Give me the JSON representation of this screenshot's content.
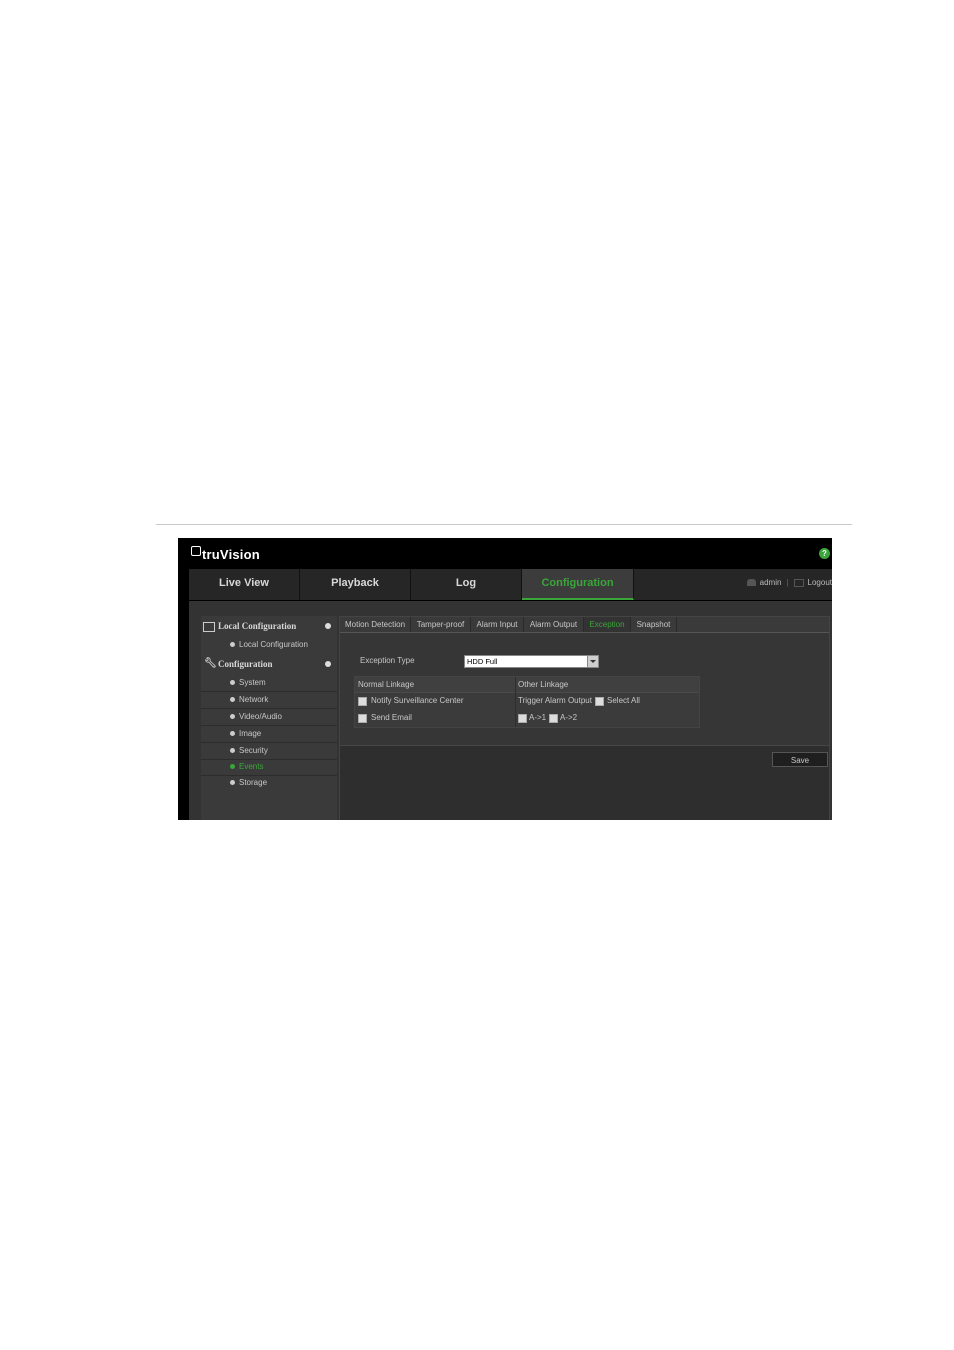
{
  "brand": {
    "logo_text": "truVision",
    "help_icon": "help-icon"
  },
  "nav": {
    "tabs": [
      {
        "label": "Live View"
      },
      {
        "label": "Playback"
      },
      {
        "label": "Log"
      },
      {
        "label": "Configuration",
        "active": true
      }
    ],
    "user": "admin",
    "logout": "Logout"
  },
  "sidebar": {
    "local_configuration": {
      "title": "Local Configuration",
      "items": [
        {
          "label": "Local Configuration"
        }
      ]
    },
    "configuration": {
      "title": "Configuration",
      "items": [
        {
          "label": "System"
        },
        {
          "label": "Network"
        },
        {
          "label": "Video/Audio"
        },
        {
          "label": "Image"
        },
        {
          "label": "Security"
        },
        {
          "label": "Events",
          "active": true
        },
        {
          "label": "Storage"
        }
      ]
    }
  },
  "subtabs": [
    {
      "label": "Motion Detection"
    },
    {
      "label": "Tamper-proof"
    },
    {
      "label": "Alarm Input"
    },
    {
      "label": "Alarm Output"
    },
    {
      "label": "Exception",
      "active": true
    },
    {
      "label": "Snapshot"
    }
  ],
  "exception": {
    "type_label": "Exception Type",
    "type_value": "HDD Full",
    "normal_linkage_header": "Normal Linkage",
    "other_linkage_header": "Other Linkage",
    "notify_surveillance_center": "Notify Surveillance Center",
    "send_email": "Send Email",
    "trigger_alarm_output": "Trigger Alarm Output",
    "select_all": "Select All",
    "output_a1": "A->1",
    "output_a2": "A->2"
  },
  "save_label": "Save",
  "colors": {
    "accent": "#3aa63a",
    "background": "#333333"
  }
}
